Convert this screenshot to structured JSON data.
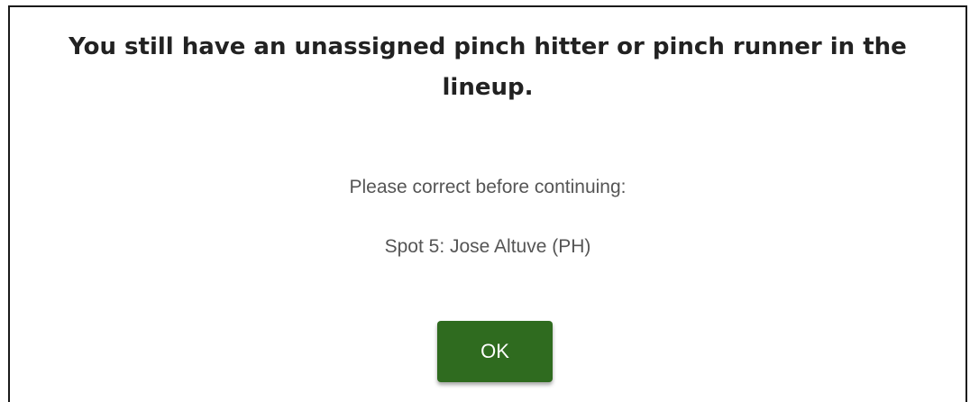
{
  "dialog": {
    "title": "You still have an unassigned pinch hitter or pinch runner in the lineup.",
    "instruction": "Please correct before continuing:",
    "detail": "Spot 5: Jose Altuve (PH)",
    "ok_label": "OK"
  },
  "colors": {
    "ok_button_bg": "#2f6b1f",
    "title_text": "#222222",
    "body_text": "#555555"
  }
}
